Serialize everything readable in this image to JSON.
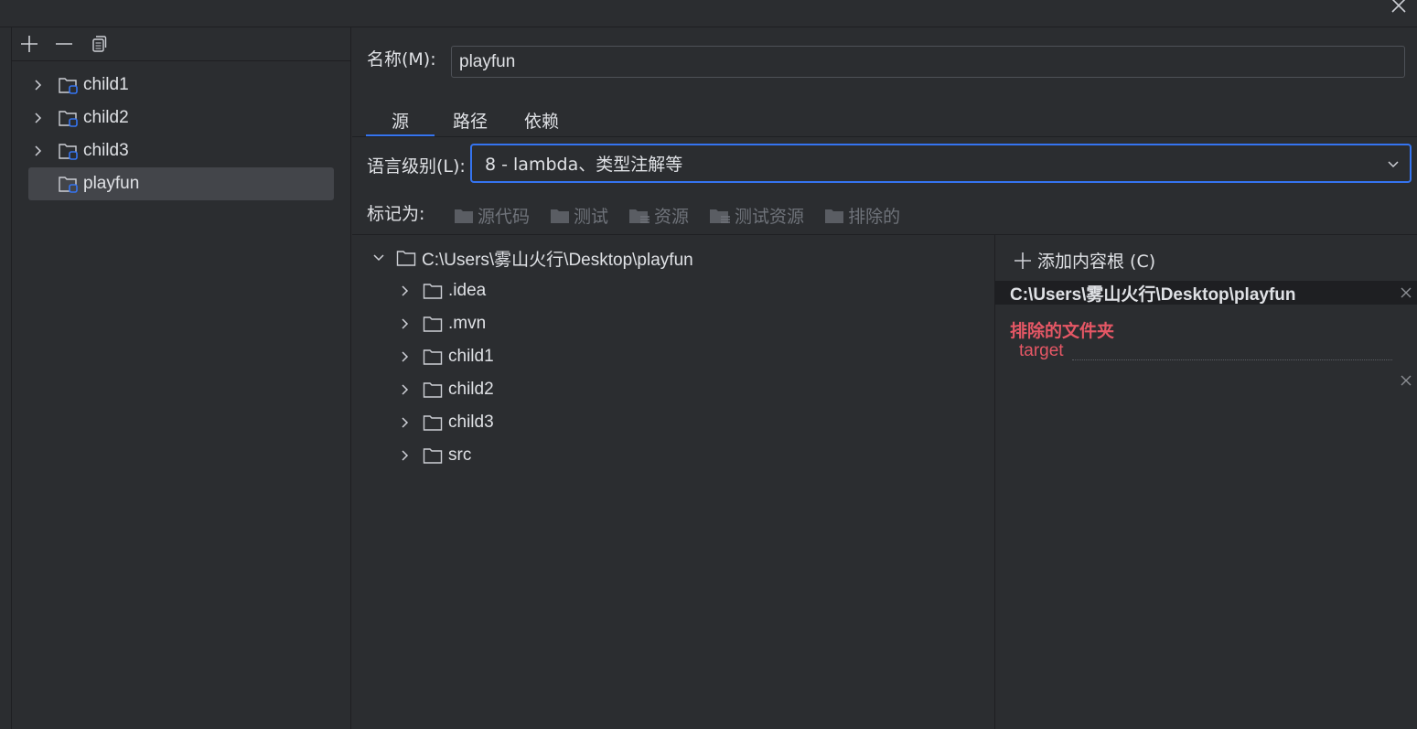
{
  "left_panel": {
    "toolbar": {
      "add_icon": "plus-icon",
      "remove_icon": "minus-icon",
      "copy_icon": "copy-icon"
    },
    "modules": [
      {
        "label": "child1",
        "expandable": true
      },
      {
        "label": "child2",
        "expandable": true
      },
      {
        "label": "child3",
        "expandable": true
      },
      {
        "label": "playfun",
        "expandable": false,
        "selected": true
      }
    ]
  },
  "right_panel": {
    "name_label": "名称(M):",
    "name_value": "playfun",
    "tabs": [
      {
        "label": "源",
        "active": true
      },
      {
        "label": "路径",
        "active": false
      },
      {
        "label": "依赖",
        "active": false
      }
    ],
    "language_level_label": "语言级别(L):",
    "language_level_value": "8 - lambda、类型注解等",
    "mark_as_label": "标记为:",
    "mark_buttons": [
      "源代码",
      "测试",
      "资源",
      "测试资源",
      "排除的"
    ],
    "content_tree": {
      "root": "C:\\Users\\雾山火行\\Desktop\\playfun",
      "children": [
        ".idea",
        ".mvn",
        "child1",
        "child2",
        "child3",
        "src"
      ]
    },
    "content_roots": {
      "add_label": "添加内容根 (C)",
      "root_path": "C:\\Users\\雾山火行\\Desktop\\playfun",
      "excluded_title": "排除的文件夹",
      "excluded_items": [
        "target"
      ]
    }
  },
  "colors": {
    "background": "#2b2d30",
    "accent": "#3574f0",
    "excluded": "#e55765",
    "text": "#dfe1e5",
    "disabled": "#6f737a"
  }
}
